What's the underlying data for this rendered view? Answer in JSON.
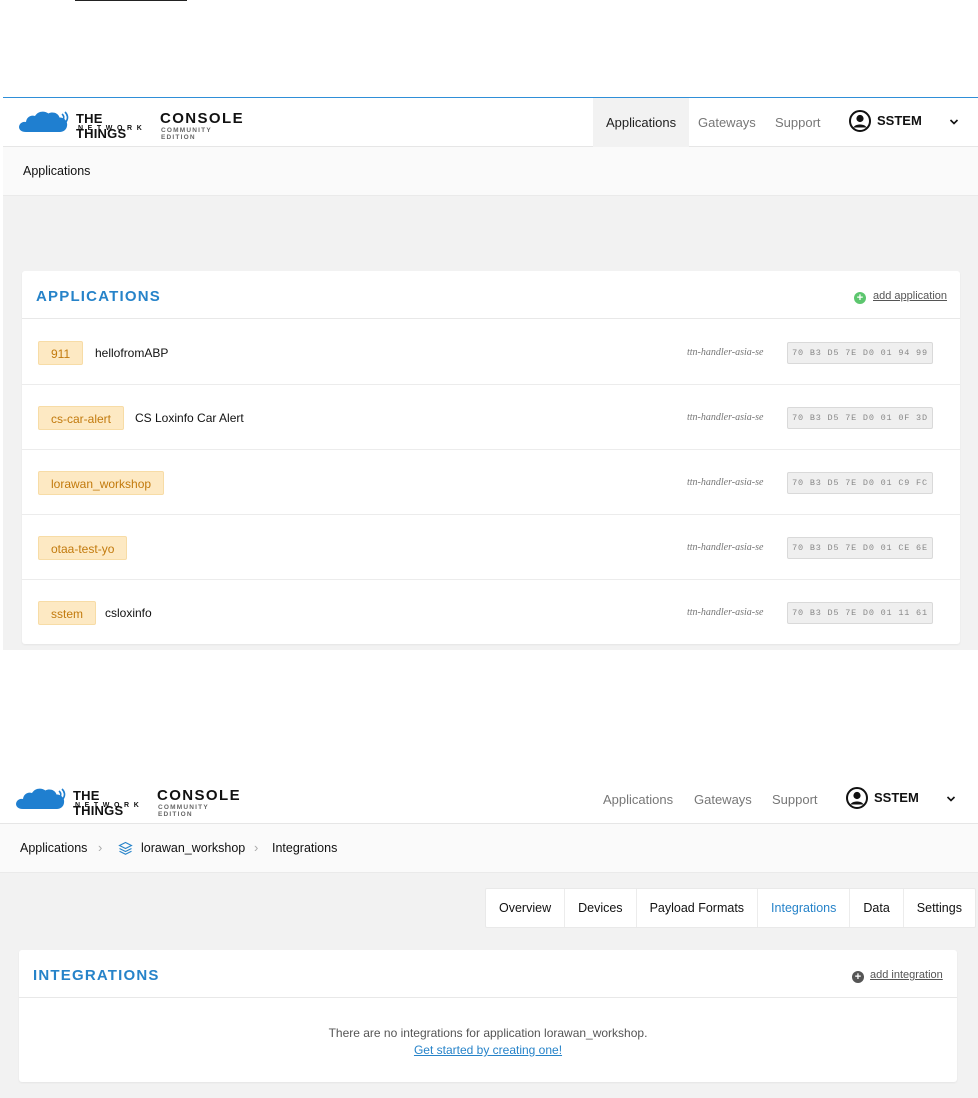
{
  "header": {
    "brand_line1": "THE THINGS",
    "brand_line2": "NETWORK",
    "product": "CONSOLE",
    "edition": "COMMUNITY EDITION",
    "nav": [
      "Applications",
      "Gateways",
      "Support"
    ],
    "user": "SSTEM"
  },
  "screen1": {
    "breadcrumb": "Applications",
    "card_title": "APPLICATIONS",
    "add_label": "add application",
    "applications": [
      {
        "id": "911",
        "name": "hellofromABP",
        "handler": "ttn-handler-asia-se",
        "eui": "70 B3 D5 7E D0 01 94 99"
      },
      {
        "id": "cs-car-alert",
        "name": "CS Loxinfo Car Alert",
        "handler": "ttn-handler-asia-se",
        "eui": "70 B3 D5 7E D0 01 0F 3D"
      },
      {
        "id": "lorawan_workshop",
        "name": "",
        "handler": "ttn-handler-asia-se",
        "eui": "70 B3 D5 7E D0 01 C9 FC"
      },
      {
        "id": "otaa-test-yo",
        "name": "",
        "handler": "ttn-handler-asia-se",
        "eui": "70 B3 D5 7E D0 01 CE 6E"
      },
      {
        "id": "sstem",
        "name": "csloxinfo",
        "handler": "ttn-handler-asia-se",
        "eui": "70 B3 D5 7E D0 01 11 61"
      }
    ]
  },
  "screen2": {
    "breadcrumb": [
      "Applications",
      "lorawan_workshop",
      "Integrations"
    ],
    "tabs": [
      "Overview",
      "Devices",
      "Payload Formats",
      "Integrations",
      "Data",
      "Settings"
    ],
    "active_tab": "Integrations",
    "card_title": "INTEGRATIONS",
    "add_label": "add integration",
    "empty_message": "There are no integrations for application lorawan_workshop.",
    "empty_link": "Get started by creating one!"
  },
  "colors": {
    "accent": "#2683c9",
    "app_id_bg": "#fde9c3",
    "app_id_text": "#c27a0d",
    "add_app_icon": "#5cc66e",
    "add_integration_icon": "#555555"
  }
}
